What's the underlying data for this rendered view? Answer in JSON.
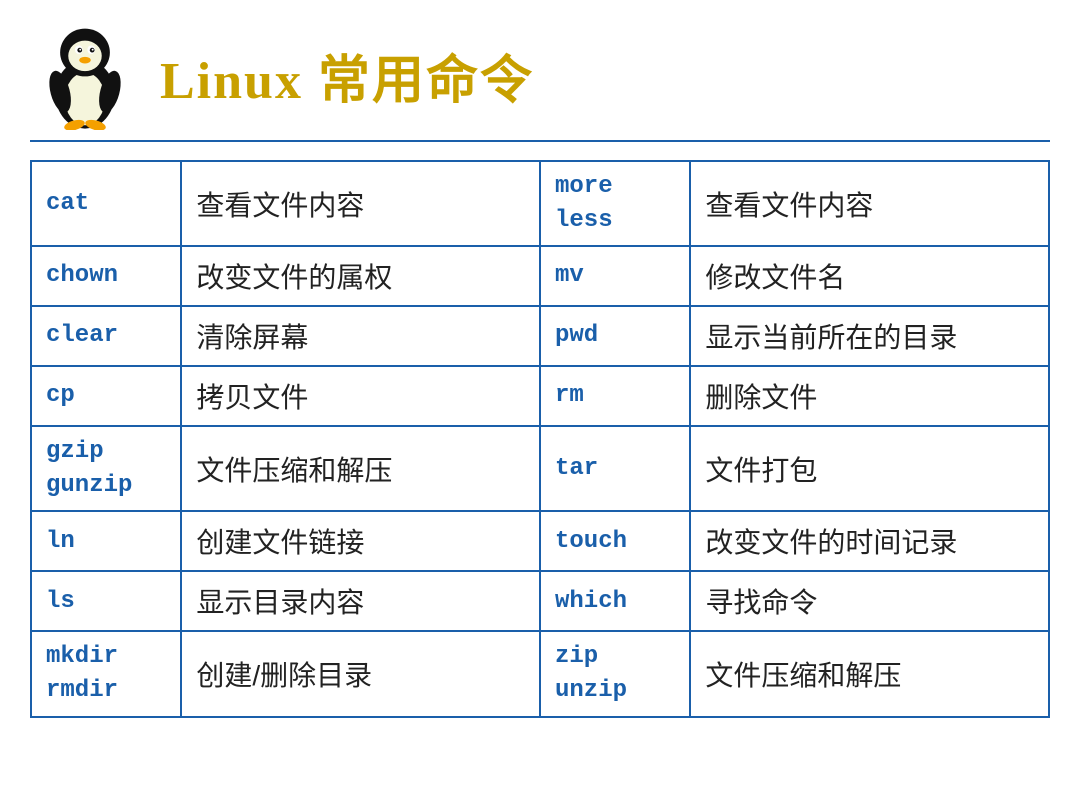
{
  "header": {
    "title_latin": "Linux",
    "title_chinese": "常用命令"
  },
  "table": {
    "rows": [
      {
        "cmd_left": "cat",
        "desc_left": "查看文件内容",
        "cmd_right": "more\nless",
        "desc_right": "查看文件内容"
      },
      {
        "cmd_left": "chown",
        "desc_left": "改变文件的属权",
        "cmd_right": "mv",
        "desc_right": "修改文件名"
      },
      {
        "cmd_left": "clear",
        "desc_left": "清除屏幕",
        "cmd_right": "pwd",
        "desc_right": "显示当前所在的目录"
      },
      {
        "cmd_left": "cp",
        "desc_left": "拷贝文件",
        "cmd_right": "rm",
        "desc_right": "删除文件"
      },
      {
        "cmd_left": "gzip\ngunzip",
        "desc_left": "文件压缩和解压",
        "cmd_right": "tar",
        "desc_right": "文件打包"
      },
      {
        "cmd_left": "ln",
        "desc_left": "创建文件链接",
        "cmd_right": "touch",
        "desc_right": "改变文件的时间记录"
      },
      {
        "cmd_left": "ls",
        "desc_left": "显示目录内容",
        "cmd_right": "which",
        "desc_right": "寻找命令"
      },
      {
        "cmd_left": "mkdir\nrmdir",
        "desc_left": "创建/删除目录",
        "cmd_right": "zip\nunzip",
        "desc_right": "文件压缩和解压"
      }
    ]
  }
}
